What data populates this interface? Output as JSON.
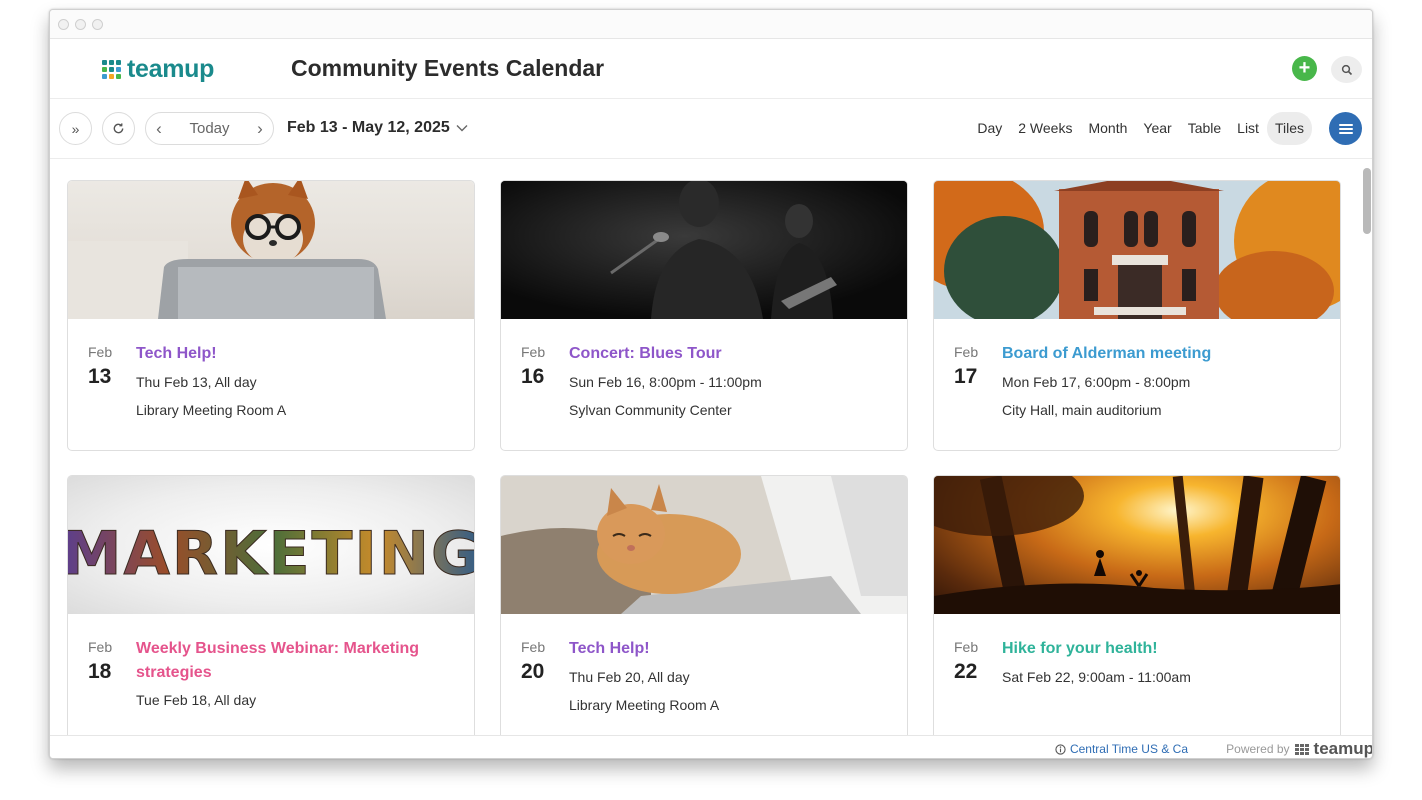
{
  "app": {
    "logo_text": "teamup",
    "title": "Community Events Calendar"
  },
  "toolbar": {
    "today_label": "Today",
    "date_range": "Feb 13 - May 12, 2025",
    "views": [
      "Day",
      "2 Weeks",
      "Month",
      "Year",
      "Table",
      "List",
      "Tiles"
    ],
    "active_view": "Tiles"
  },
  "events": [
    {
      "month": "Feb",
      "day": "13",
      "title": "Tech Help!",
      "when": "Thu Feb 13, All day",
      "where": "Library Meeting Room A",
      "color": "#8e56c9",
      "image": "dog-glasses-laptop"
    },
    {
      "month": "Feb",
      "day": "16",
      "title": "Concert: Blues Tour",
      "when": "Sun Feb 16, 8:00pm - 11:00pm",
      "where": "Sylvan Community Center",
      "color": "#8e56c9",
      "image": "singer-stage"
    },
    {
      "month": "Feb",
      "day": "17",
      "title": "Board of Alderman meeting",
      "when": "Mon Feb 17, 6:00pm - 8:00pm",
      "where": "City Hall, main auditorium",
      "color": "#3c9bd0",
      "image": "brick-building-autumn"
    },
    {
      "month": "Feb",
      "day": "18",
      "title": "Weekly Business Webinar: Marketing strategies",
      "when": "Tue Feb 18, All day",
      "where": "",
      "color": "#e5548c",
      "image": "marketing-text",
      "image_text": "MARKETING"
    },
    {
      "month": "Feb",
      "day": "20",
      "title": "Tech Help!",
      "when": "Thu Feb 20, All day",
      "where": "Library Meeting Room A",
      "color": "#8e56c9",
      "image": "cat-laptop"
    },
    {
      "month": "Feb",
      "day": "22",
      "title": "Hike for your health!",
      "when": "Sat Feb 22, 9:00am - 11:00am",
      "where": "",
      "color": "#2fb39a",
      "image": "sunset-forest-hikers"
    }
  ],
  "footer": {
    "timezone": "Central Time US & Ca",
    "powered_by": "Powered by",
    "powered_logo": "teamup"
  },
  "colors": {
    "brand": "#1a8a8c",
    "add_button": "#48b74a",
    "menu_button": "#2f6db4"
  },
  "icons": {
    "expand": "double-chevron-right-icon",
    "refresh": "refresh-icon",
    "prev": "chevron-left-icon",
    "next": "chevron-right-icon",
    "add": "plus-icon",
    "search": "search-icon",
    "menu": "hamburger-menu-icon",
    "timezone": "info-icon"
  }
}
